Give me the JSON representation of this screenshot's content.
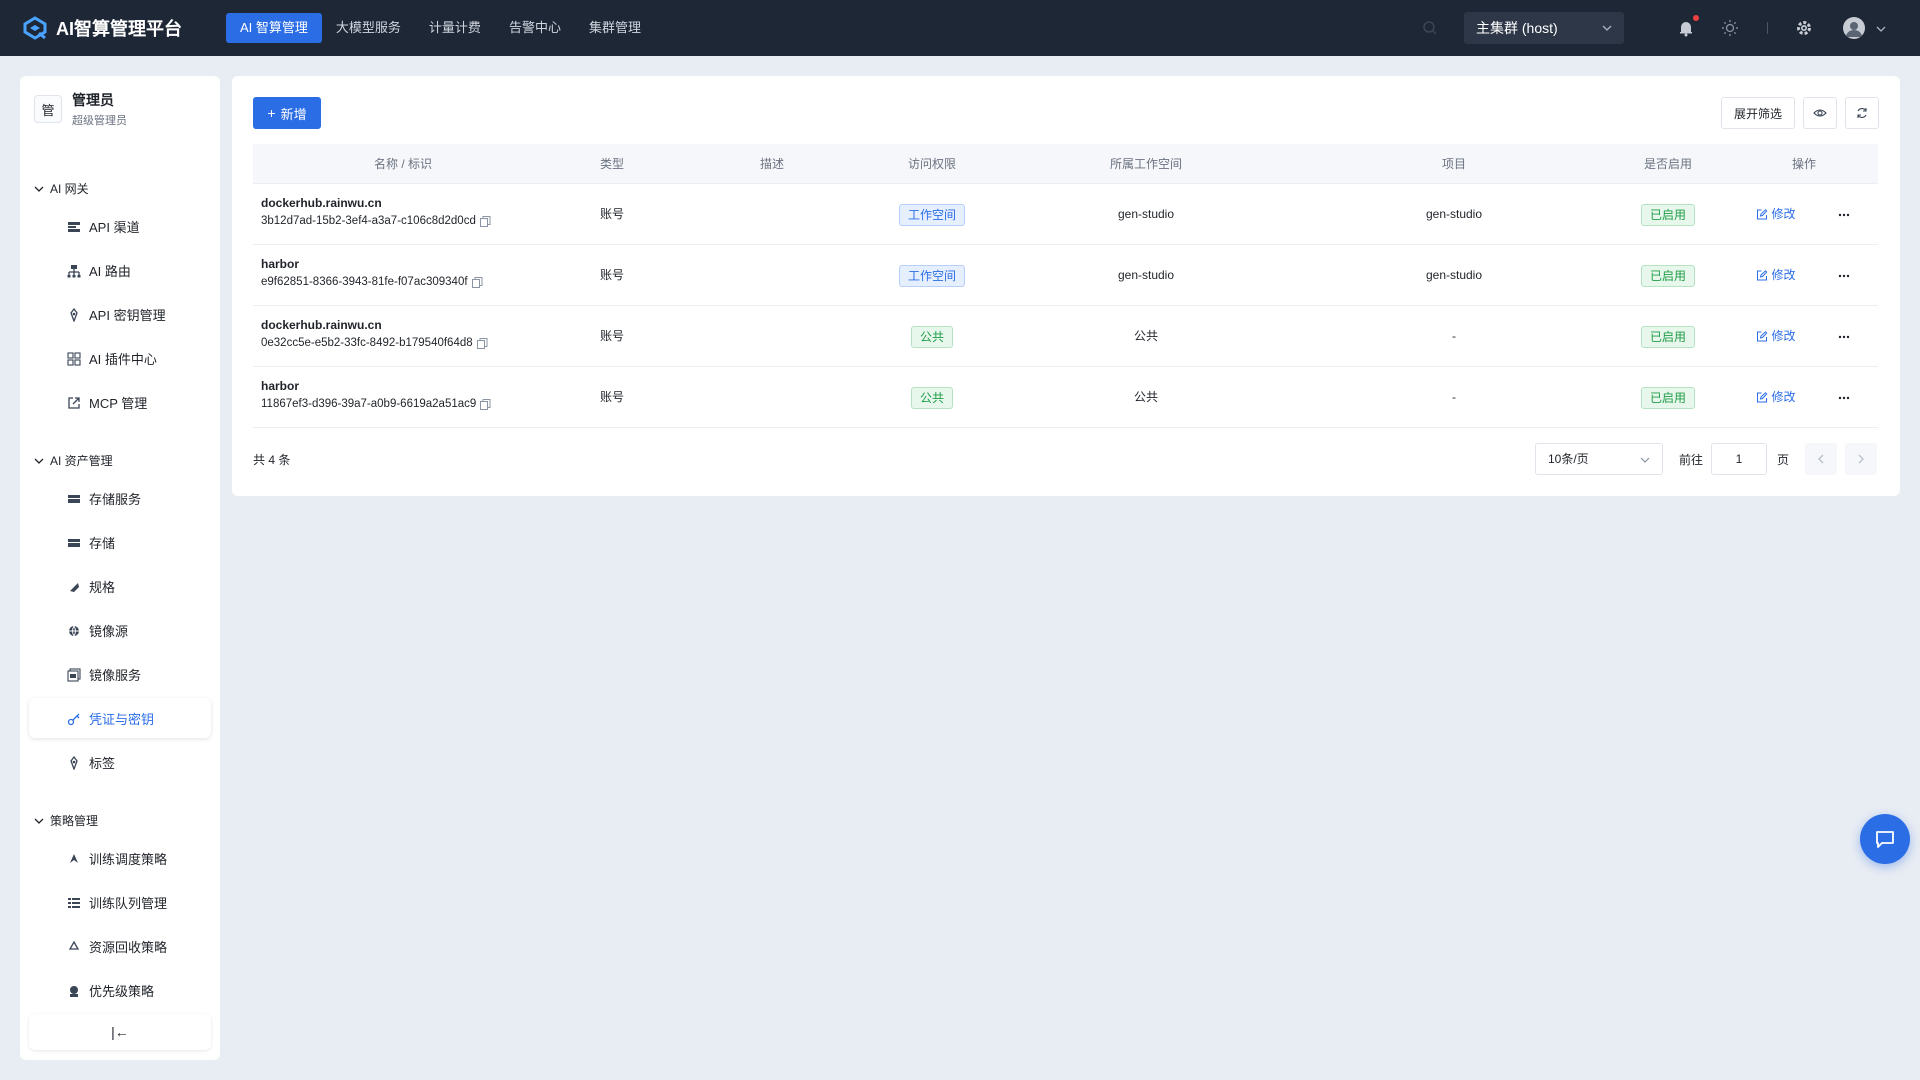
{
  "topbar": {
    "brand_title": "AI智算管理平台",
    "nav": [
      {
        "label": "AI 智算管理",
        "active": true
      },
      {
        "label": "大模型服务",
        "active": false
      },
      {
        "label": "计量计费",
        "active": false
      },
      {
        "label": "告警中心",
        "active": false
      },
      {
        "label": "集群管理",
        "active": false
      }
    ],
    "cluster_select": "主集群 (host)",
    "accent_color": "#2b6de5",
    "bg_color": "#1e2736"
  },
  "sidebar": {
    "user": {
      "avatar_char": "管",
      "name": "管理员",
      "role": "超级管理员"
    },
    "groups": [
      {
        "label": "AI 网关",
        "items": [
          {
            "label": "API 渠道",
            "icon": "api-channel-icon"
          },
          {
            "label": "AI 路由",
            "icon": "route-icon"
          },
          {
            "label": "API 密钥管理",
            "icon": "key-icon"
          },
          {
            "label": "AI 插件中心",
            "icon": "plugin-grid-icon"
          },
          {
            "label": "MCP 管理",
            "icon": "external-link-icon"
          }
        ]
      },
      {
        "label": "AI 资产管理",
        "items": [
          {
            "label": "存储服务",
            "icon": "storage-icon"
          },
          {
            "label": "存储",
            "icon": "disk-icon"
          },
          {
            "label": "规格",
            "icon": "spec-icon"
          },
          {
            "label": "镜像源",
            "icon": "globe-icon"
          },
          {
            "label": "镜像服务",
            "icon": "image-icon"
          },
          {
            "label": "凭证与密钥",
            "icon": "credential-key-icon",
            "active": true
          },
          {
            "label": "标签",
            "icon": "tag-icon"
          }
        ]
      },
      {
        "label": "策略管理",
        "items": [
          {
            "label": "训练调度策略",
            "icon": "schedule-icon"
          },
          {
            "label": "训练队列管理",
            "icon": "queue-icon"
          },
          {
            "label": "资源回收策略",
            "icon": "recycle-icon"
          },
          {
            "label": "优先级策略",
            "icon": "priority-icon"
          }
        ]
      }
    ],
    "collapse_symbol": "|←"
  },
  "toolbar": {
    "add_label": "新增",
    "filter_label": "展开筛选"
  },
  "table": {
    "columns": [
      "名称 / 标识",
      "类型",
      "描述",
      "访问权限",
      "所属工作空间",
      "项目",
      "是否启用",
      "操作"
    ],
    "rows": [
      {
        "name": "dockerhub.rainwu.cn",
        "id": "3b12d7ad-15b2-3ef4-a3a7-c106c8d2d0cd",
        "type": "账号",
        "desc": "",
        "access": "工作空间",
        "access_kind": "blue",
        "workspace": "gen-studio",
        "project": "gen-studio",
        "enabled": "已启用",
        "edit": "修改"
      },
      {
        "name": "harbor",
        "id": "e9f62851-8366-3943-81fe-f07ac309340f",
        "type": "账号",
        "desc": "",
        "access": "工作空间",
        "access_kind": "blue",
        "workspace": "gen-studio",
        "project": "gen-studio",
        "enabled": "已启用",
        "edit": "修改"
      },
      {
        "name": "dockerhub.rainwu.cn",
        "id": "0e32cc5e-e5b2-33fc-8492-b179540f64d8",
        "type": "账号",
        "desc": "",
        "access": "公共",
        "access_kind": "green",
        "workspace": "公共",
        "project": "-",
        "enabled": "已启用",
        "edit": "修改"
      },
      {
        "name": "harbor",
        "id": "11867ef3-d396-39a7-a0b9-6619a2a51ac9",
        "type": "账号",
        "desc": "",
        "access": "公共",
        "access_kind": "green",
        "workspace": "公共",
        "project": "-",
        "enabled": "已启用",
        "edit": "修改"
      }
    ]
  },
  "pagination": {
    "total": "共 4 条",
    "page_size": "10条/页",
    "goto_label": "前往",
    "page": "1",
    "page_unit": "页"
  }
}
